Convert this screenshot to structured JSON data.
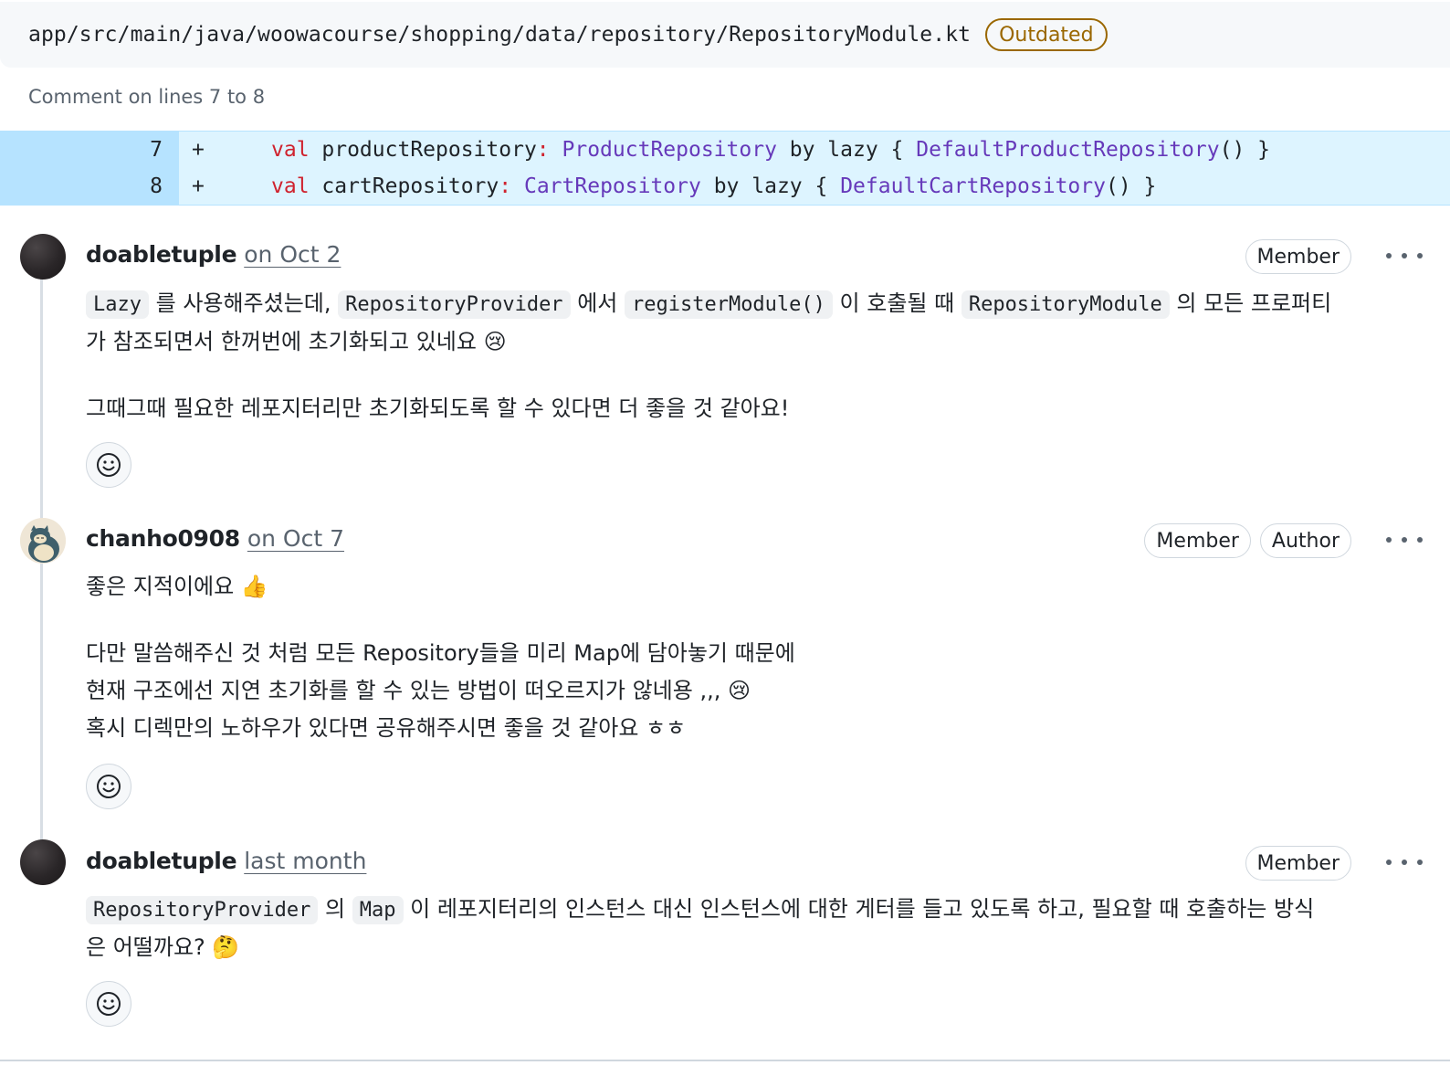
{
  "file": {
    "path": "app/src/main/java/woowacourse/shopping/data/repository/RepositoryModule.kt",
    "status_badge": "Outdated"
  },
  "comment_range": "Comment on lines 7 to 8",
  "diff": [
    {
      "line": "7",
      "sign": "+",
      "kw": "val",
      "name": " productRepository",
      "colon": ":",
      "type": "ProductRepository",
      "mid": " by lazy { ",
      "impl": "DefaultProductRepository",
      "end": "() }"
    },
    {
      "line": "8",
      "sign": "+",
      "kw": "val",
      "name": " cartRepository",
      "colon": ":",
      "type": "CartRepository",
      "mid": " by lazy { ",
      "impl": "DefaultCartRepository",
      "end": "() }"
    }
  ],
  "comments": [
    {
      "author": "doabletuple",
      "timestamp": "on Oct 2",
      "badges": [
        "Member"
      ],
      "p1": {
        "c1": "Lazy",
        "t1": " 를 사용해주셨는데, ",
        "c2": "RepositoryProvider",
        "t2": " 에서 ",
        "c3": "registerModule()",
        "t3": " 이 호출될 때 ",
        "c4": "RepositoryModule",
        "t4": " 의 모든 프로퍼티",
        "t5": "가 참조되면서 한꺼번에 초기화되고 있네요 😢"
      },
      "p2": "그때그때 필요한 레포지터리만 초기화되도록 할 수 있다면 더 좋을 것 같아요!"
    },
    {
      "author": "chanho0908",
      "timestamp": "on Oct 7",
      "badges": [
        "Member",
        "Author"
      ],
      "p1": "좋은 지적이에요 👍",
      "p2": "다만 말씀해주신 것 처럼 모든 Repository들을 미리 Map에 담아놓기 때문에",
      "p3": "현재 구조에선 지연 초기화를 할 수 있는 방법이 떠오르지가 않네용 ,,, 😢",
      "p4": "혹시 디렉만의 노하우가 있다면 공유해주시면 좋을 것 같아요 ㅎㅎ"
    },
    {
      "author": "doabletuple",
      "timestamp": "last month",
      "badges": [
        "Member"
      ],
      "p1": {
        "c1": "RepositoryProvider",
        "t1": " 의 ",
        "c2": "Map",
        "t2": " 이 레포지터리의 인스턴스 대신 인스턴스에 대한 게터를 들고 있도록 하고, 필요할 때 호출하는 방식",
        "t3": "은 어떨까요? 🤔"
      }
    }
  ],
  "icons": {
    "more": "kebab-horizontal-icon",
    "reaction": "smiley-icon"
  }
}
